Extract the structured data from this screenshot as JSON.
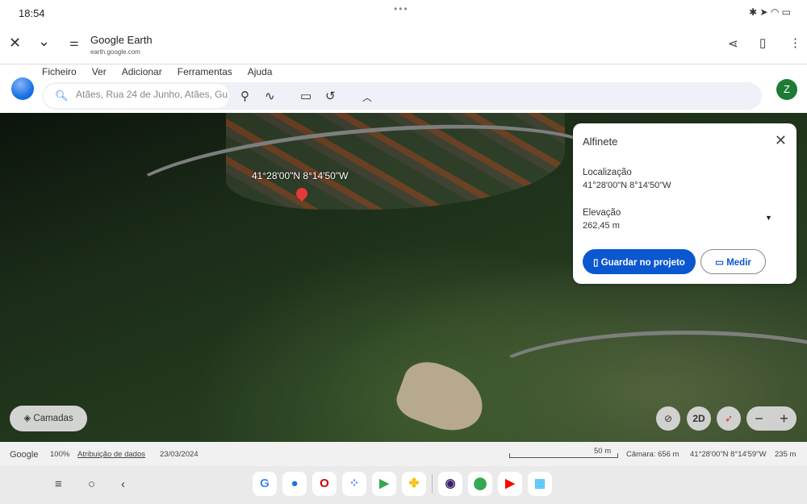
{
  "status": {
    "time": "18:54",
    "dots": "•••",
    "icons": "✱ ➤ ◠ ▭"
  },
  "browser": {
    "title": "Google Earth",
    "url": "earth.google.com"
  },
  "menu": [
    "Ficheiro",
    "Ver",
    "Adicionar",
    "Ferramentas",
    "Ajuda"
  ],
  "search": {
    "value": "Atães, Rua 24 de Junho, Atães, Gu"
  },
  "avatar": "Z",
  "map": {
    "pin_label": "41°28'00\"N 8°14'50\"W",
    "layers_label": "Camadas",
    "mode_2d": "2D"
  },
  "card": {
    "title": "Alfinete",
    "location_label": "Localização",
    "location_value": "41°28'00\"N 8°14'50\"W",
    "elevation_label": "Elevação",
    "elevation_value": "262,45 m",
    "save_label": "Guardar no projeto",
    "measure_label": "Medir"
  },
  "footer": {
    "brand": "Google",
    "zoom": "100%",
    "attribution": "Atribuição de dados",
    "date": "23/03/2024",
    "scale": "50 m",
    "camera": "Câmara: 656 m",
    "coords": "41°28'00\"N 8°14'59\"W",
    "elev": "235 m"
  },
  "dock": [
    {
      "name": "google",
      "glyph": "G",
      "color": "#4285f4"
    },
    {
      "name": "messages",
      "glyph": "●",
      "color": "#1a73e8"
    },
    {
      "name": "opera",
      "glyph": "O",
      "color": "#d50000"
    },
    {
      "name": "assistant",
      "glyph": "⁘",
      "color": "#4285f4"
    },
    {
      "name": "play-store",
      "glyph": "▶",
      "color": "#34a853"
    },
    {
      "name": "photos",
      "glyph": "✤",
      "color": "#fbbc04"
    },
    {
      "name": "camera",
      "glyph": "◉",
      "color": "#3f1d6b"
    },
    {
      "name": "maps",
      "glyph": "⬤",
      "color": "#34a853"
    },
    {
      "name": "youtube",
      "glyph": "▶",
      "color": "#ff0000"
    },
    {
      "name": "apps",
      "glyph": "▦",
      "color": "#4fc3f7"
    }
  ]
}
